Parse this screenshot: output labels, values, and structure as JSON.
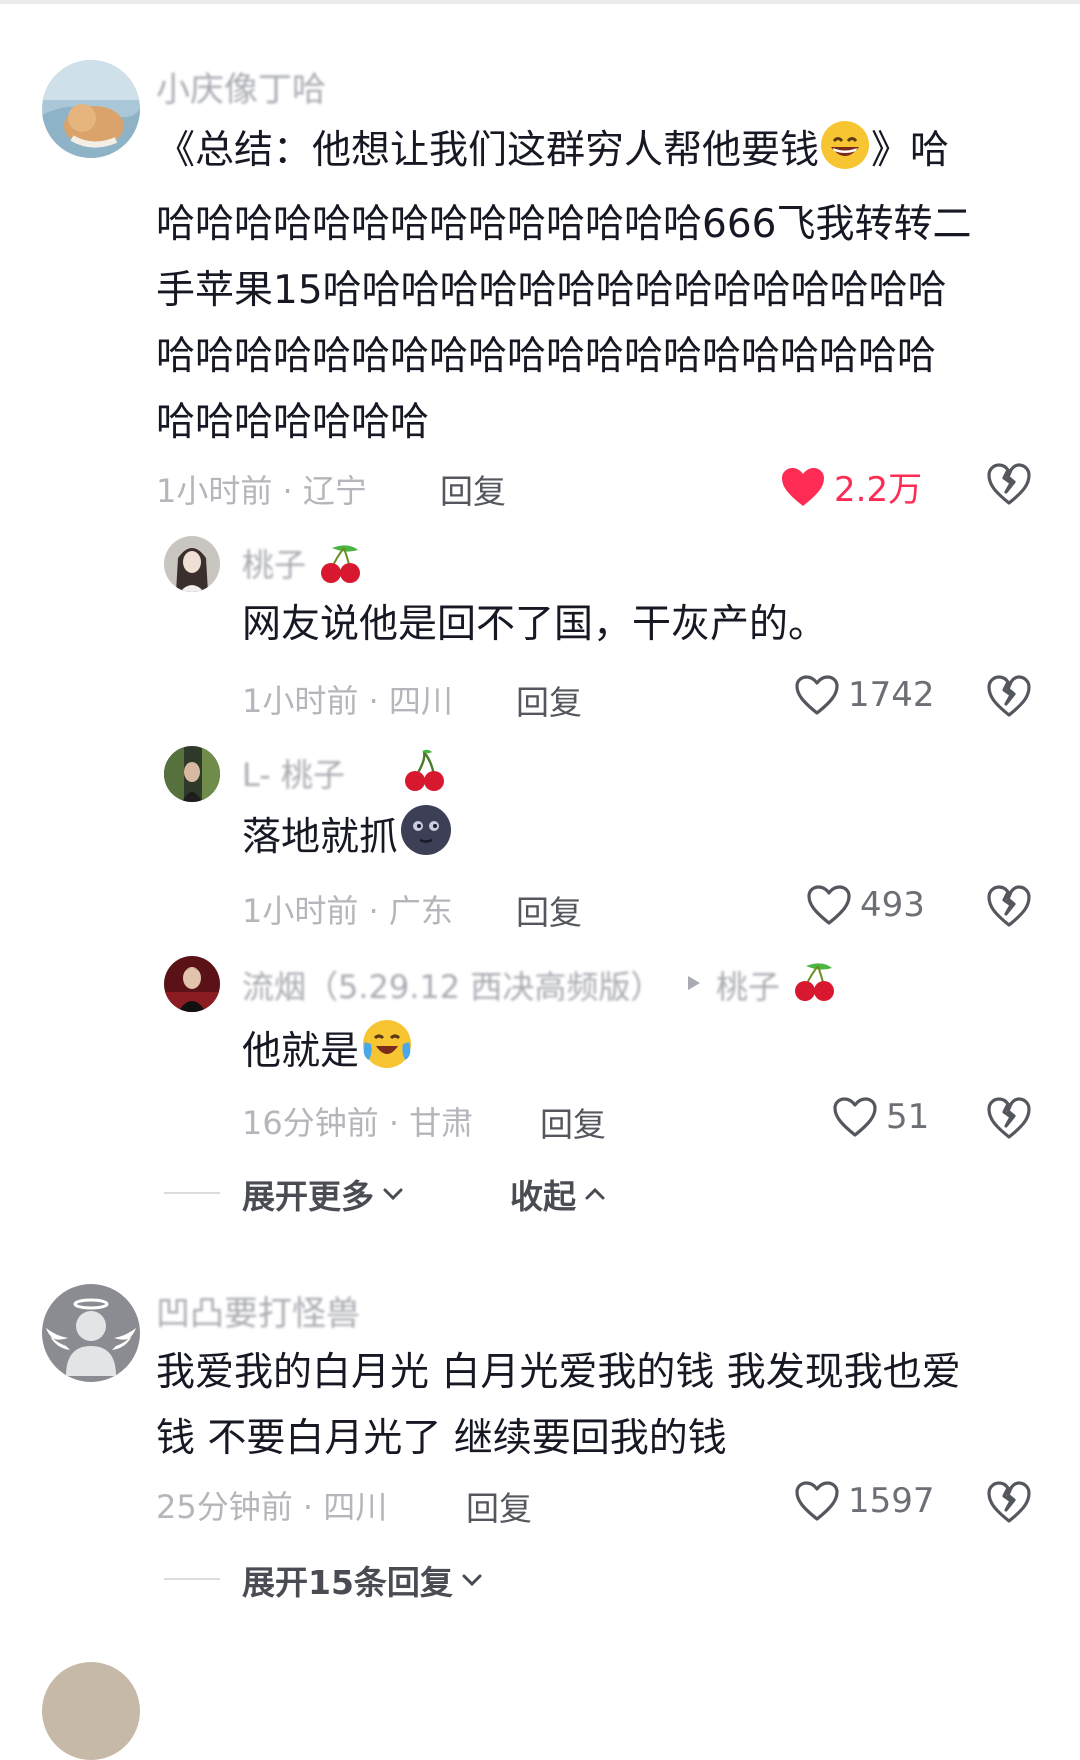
{
  "comments": [
    {
      "username": "小庆像丁哈",
      "text": "《总结：他想让我们这群穷人帮他要钱😁》哈哈哈哈哈哈哈哈哈哈哈哈哈哈666飞我转转二手苹果15哈哈哈哈哈哈哈哈哈哈哈哈哈哈哈哈哈哈哈哈哈哈哈哈哈哈哈哈哈哈哈哈哈哈哈哈哈哈哈哈哈",
      "text_lines": [
        "《总结：他想让我们这群穷人帮他要钱",
        "》哈",
        "哈哈哈哈哈哈哈哈哈哈哈哈哈哈666飞我转转二",
        "手苹果15哈哈哈哈哈哈哈哈哈哈哈哈哈哈哈哈",
        "哈哈哈哈哈哈哈哈哈哈哈哈哈哈哈哈哈哈哈哈",
        "哈哈哈哈哈哈哈"
      ],
      "meta": "1小时前 · 辽宁",
      "reply_label": "回复",
      "likes": "2.2万",
      "liked": true
    },
    {
      "username": "凹凸要打怪兽",
      "text_lines": [
        "我爱我的白月光 白月光爱我的钱 我发现我也爱",
        "钱 不要白月光了 继续要回我的钱"
      ],
      "meta": "25分钟前 · 四川",
      "reply_label": "回复",
      "likes": "1597",
      "liked": false,
      "expand_label": "展开15条回复"
    }
  ],
  "replies": [
    {
      "username": "桃子",
      "text": "网友说他是回不了国，干灰产的。",
      "meta": "1小时前 · 四川",
      "reply_label": "回复",
      "likes": "1742"
    },
    {
      "username": "L- 桃子",
      "text": "落地就抓",
      "meta": "1小时前 · 广东",
      "reply_label": "回复",
      "likes": "493"
    },
    {
      "username": "流烟（5.29.12 西决高频版）",
      "reply_to": "桃子",
      "text": "他就是",
      "meta": "16分钟前 · 甘肃",
      "reply_label": "回复",
      "likes": "51"
    }
  ],
  "thread_controls": {
    "expand_more": "展开更多",
    "collapse": "收起"
  },
  "colors": {
    "liked": "#fe2c55",
    "meta": "#b5b6bb",
    "text": "#161823"
  }
}
